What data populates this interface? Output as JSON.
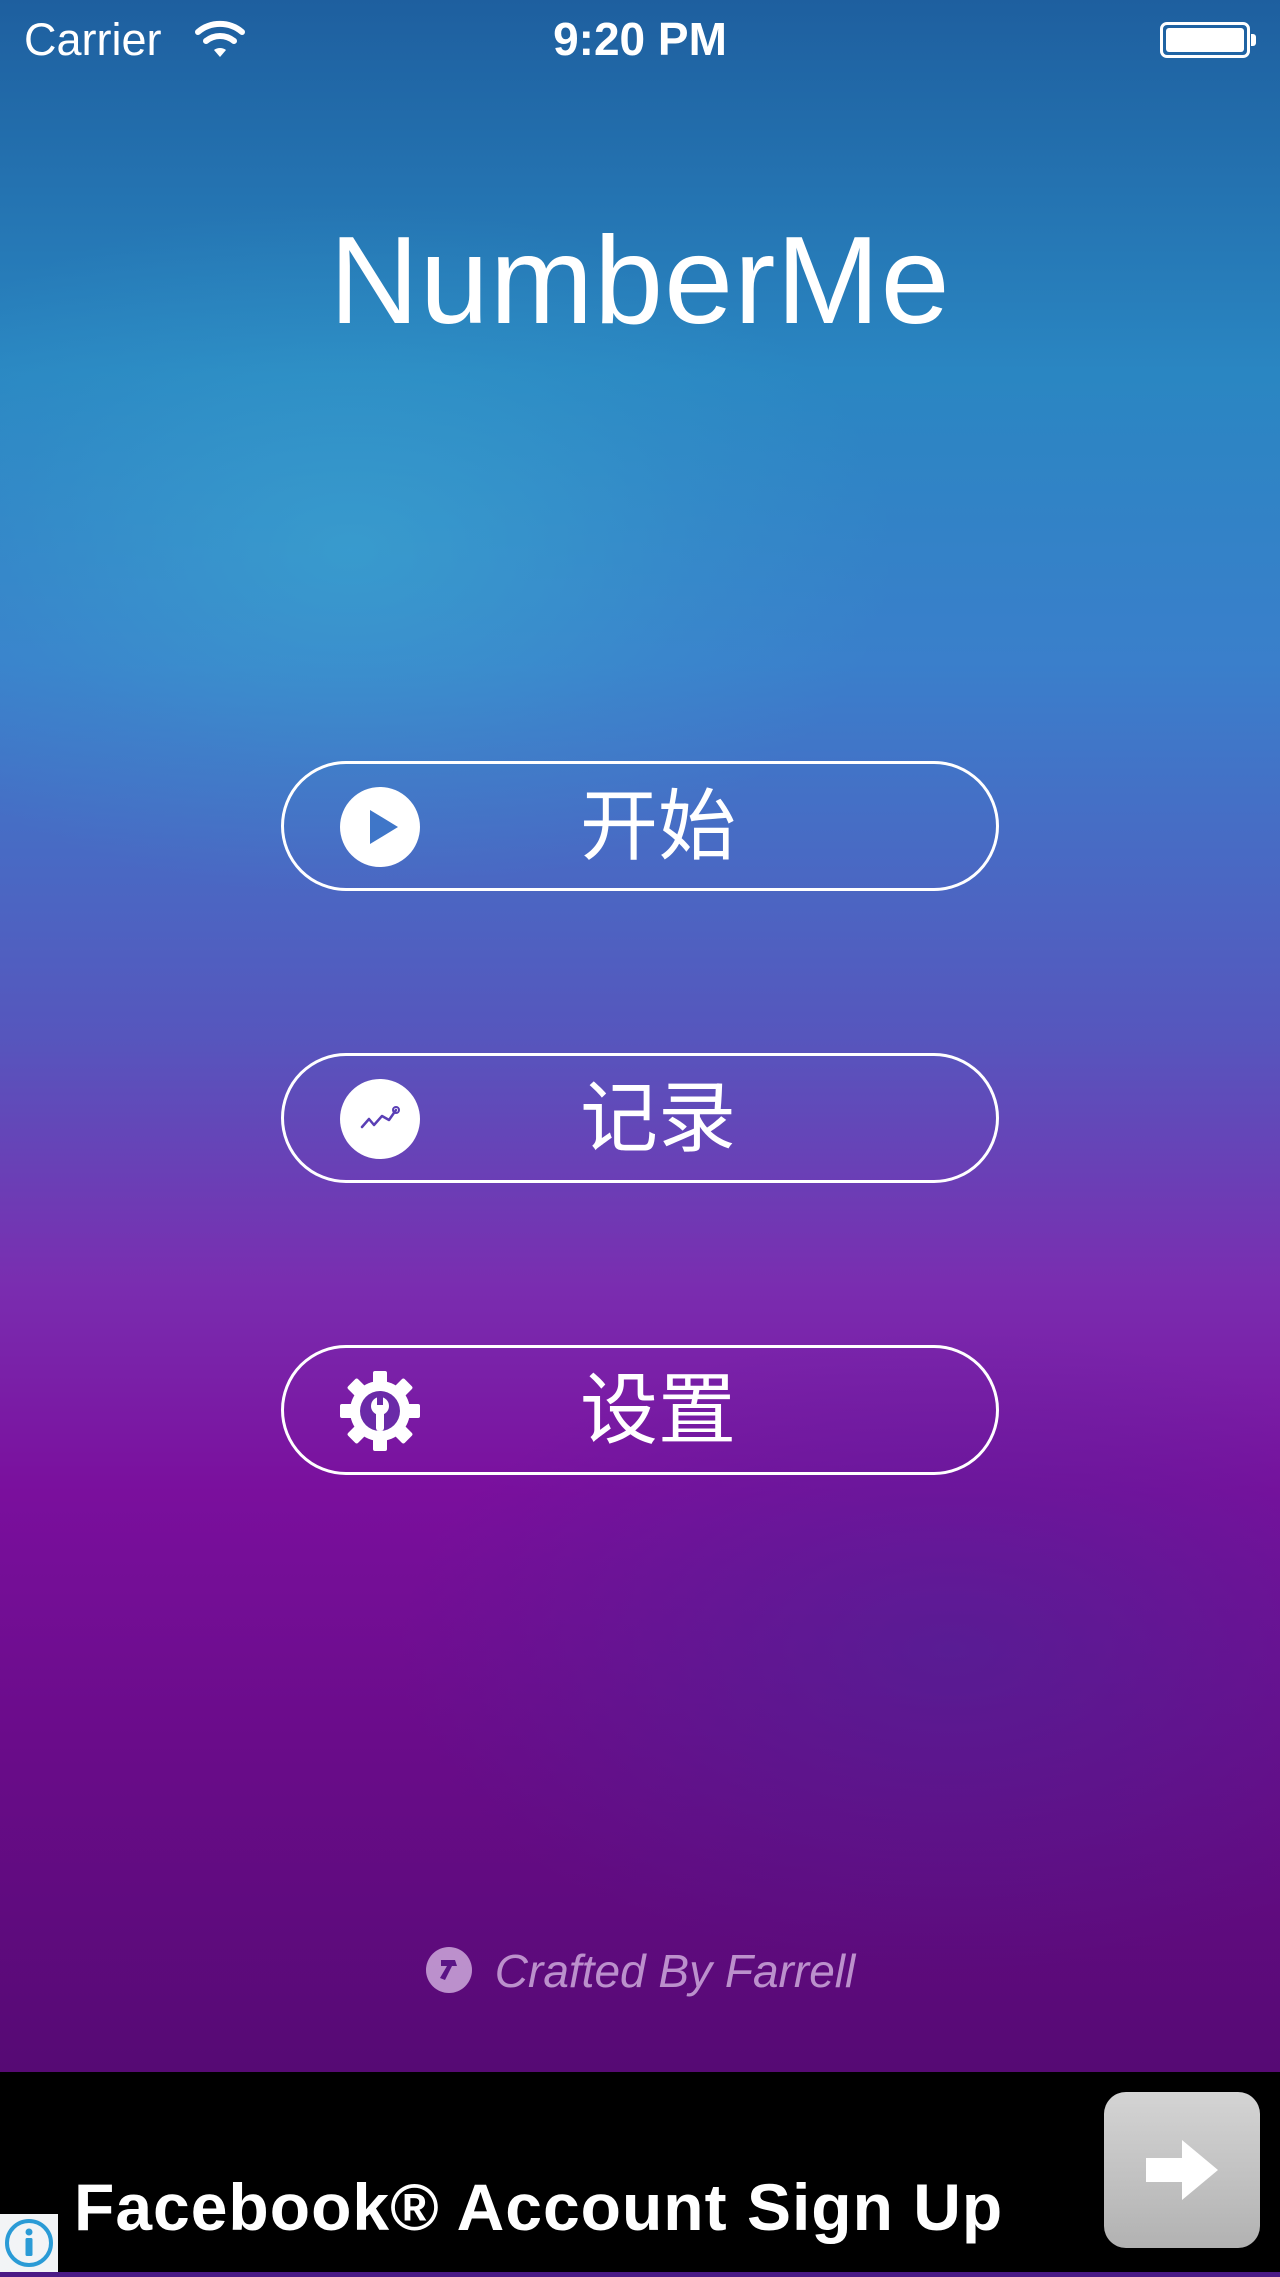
{
  "status_bar": {
    "carrier": "Carrier",
    "time": "9:20 PM",
    "wifi_icon": "wifi-icon",
    "battery_icon": "battery-icon"
  },
  "app": {
    "title": "NumberMe"
  },
  "menu": [
    {
      "label": "开始",
      "icon": "play-icon"
    },
    {
      "label": "记录",
      "icon": "chart-line-icon"
    },
    {
      "label": "设置",
      "icon": "gear-wrench-icon"
    }
  ],
  "footer": {
    "credit": "Crafted By Farrell",
    "icon": "hammer-icon"
  },
  "ad": {
    "text": "Facebook® Account Sign Up",
    "button_icon": "arrow-right-icon",
    "info_icon": "info-icon"
  },
  "colors": {
    "gradient_top": "#1e5f9f",
    "gradient_mid": "#3a7fcb",
    "gradient_purple": "#7a0f9d",
    "gradient_bottom": "#560a74",
    "button_outline": "#ffffff",
    "ad_background": "#000000"
  }
}
